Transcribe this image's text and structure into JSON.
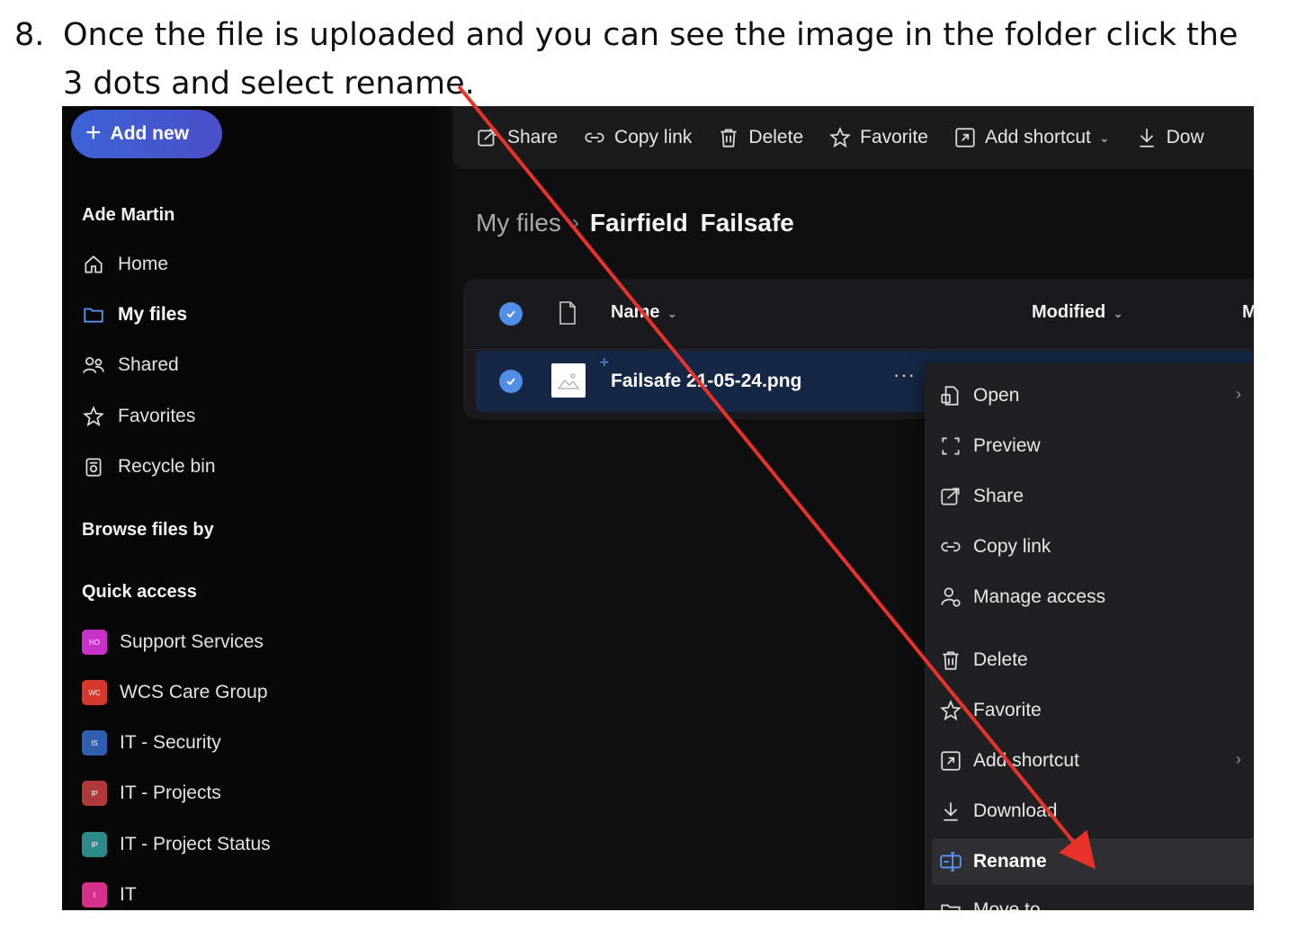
{
  "instruction": {
    "number": "8.",
    "line1": "Once the file is uploaded and you can see the image in the folder click the",
    "line2": "3 dots and select rename."
  },
  "sidebar": {
    "add_new_label": "Add new",
    "user_name": "Ade Martin",
    "nav": [
      {
        "label": "Home",
        "icon": "home-icon"
      },
      {
        "label": "My files",
        "icon": "folder-icon"
      },
      {
        "label": "Shared",
        "icon": "people-icon"
      },
      {
        "label": "Favorites",
        "icon": "star-icon"
      },
      {
        "label": "Recycle bin",
        "icon": "recycle-bin-icon"
      }
    ],
    "browse_heading": "Browse files by",
    "quick_access_heading": "Quick access",
    "quick_access": [
      {
        "label": "Support Services",
        "badge": "HO",
        "color": "#c832c8"
      },
      {
        "label": "WCS Care Group",
        "badge": "WC",
        "color": "#d7382c"
      },
      {
        "label": "IT - Security",
        "badge": "IS",
        "color": "#2f5db0"
      },
      {
        "label": "IT - Projects",
        "badge": "IP",
        "color": "#b03a3a"
      },
      {
        "label": "IT - Project Status",
        "badge": "IP",
        "color": "#2e8a8a"
      },
      {
        "label": "IT",
        "badge": "I",
        "color": "#d6308a"
      }
    ]
  },
  "commandbar": {
    "items": [
      {
        "label": "Share",
        "icon": "share-icon"
      },
      {
        "label": "Copy link",
        "icon": "link-icon"
      },
      {
        "label": "Delete",
        "icon": "trash-icon"
      },
      {
        "label": "Favorite",
        "icon": "star-icon"
      },
      {
        "label": "Add shortcut",
        "icon": "shortcut-icon"
      },
      {
        "label": "Dow",
        "icon": "download-icon"
      }
    ]
  },
  "breadcrumb": {
    "root": "My files",
    "current": "Fairfield Failsafe"
  },
  "filelist": {
    "columns": {
      "name": "Name",
      "modified": "Modified",
      "third": "M"
    },
    "row": {
      "name": "Failsafe 21-05-24.png",
      "more": "···"
    }
  },
  "context_menu": {
    "items": [
      {
        "label": "Open",
        "icon": "open-icon",
        "submenu": true
      },
      {
        "label": "Preview",
        "icon": "preview-icon"
      },
      {
        "label": "Share",
        "icon": "share-icon"
      },
      {
        "label": "Copy link",
        "icon": "link-icon"
      },
      {
        "label": "Manage access",
        "icon": "manage-access-icon"
      },
      {
        "label": "Delete",
        "icon": "trash-icon"
      },
      {
        "label": "Favorite",
        "icon": "star-icon"
      },
      {
        "label": "Add shortcut",
        "icon": "shortcut-icon",
        "submenu": true
      },
      {
        "label": "Download",
        "icon": "download-icon"
      },
      {
        "label": "Rename",
        "icon": "rename-icon"
      },
      {
        "label": "Move to",
        "icon": "move-icon"
      }
    ]
  },
  "colors": {
    "accent": "#4f8fe8",
    "annotation_arrow": "#e8322a"
  }
}
